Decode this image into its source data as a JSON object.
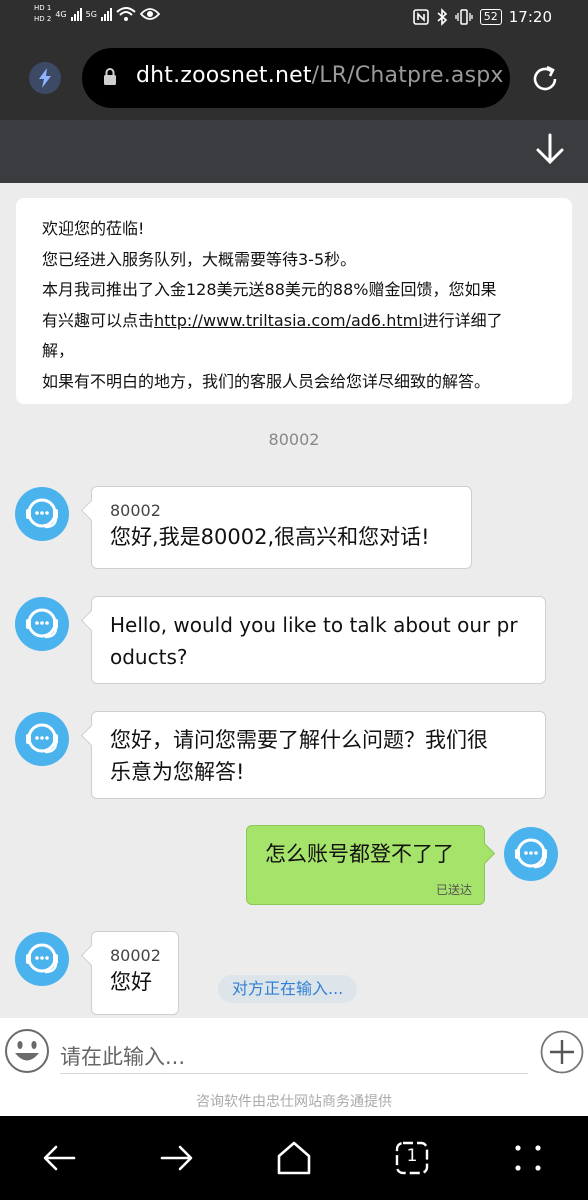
{
  "status_bar": {
    "hd1": "HD 1",
    "hd2": "HD 2",
    "net1": "4G",
    "net2": "5G",
    "battery": "52",
    "time": "17:20"
  },
  "address_bar": {
    "domain": "dht.zoosnet.net",
    "path": "/LR/Chatpre.aspx"
  },
  "welcome": {
    "line1": "欢迎您的莅临!",
    "line2": "您已经进入服务队列，大概需要等待3-5秒。",
    "line3": "本月我司推出了入金128美元送88美元的88%赠金回馈，您如果",
    "line4_prefix": "有兴趣可以点击",
    "line4_link": "http://www.triltasia.com/ad6.html",
    "line4_suffix": "进行详细了",
    "line5": "解，",
    "line6": "如果有不明白的地方，我们的客服人员会给您详尽细致的解答。"
  },
  "agent_id_divider": "80002",
  "messages": [
    {
      "sender": "80002",
      "text": "您好,我是80002,很高兴和您对话!"
    },
    {
      "text_line1": "Hello, would you like to talk about our pr",
      "text_line2": "oducts?"
    },
    {
      "text_line1": "您好，请问您需要了解什么问题？我们很",
      "text_line2": "乐意为您解答!"
    },
    {
      "text": "怎么账号都登不了了",
      "status": "已送达"
    },
    {
      "sender": "80002",
      "text": "您好"
    }
  ],
  "typing_indicator": "对方正在输入...",
  "input": {
    "placeholder": "请在此输入..."
  },
  "powered_by": "咨询软件由忠仕网站商务通提供",
  "nav": {
    "tabs_count": "1"
  }
}
